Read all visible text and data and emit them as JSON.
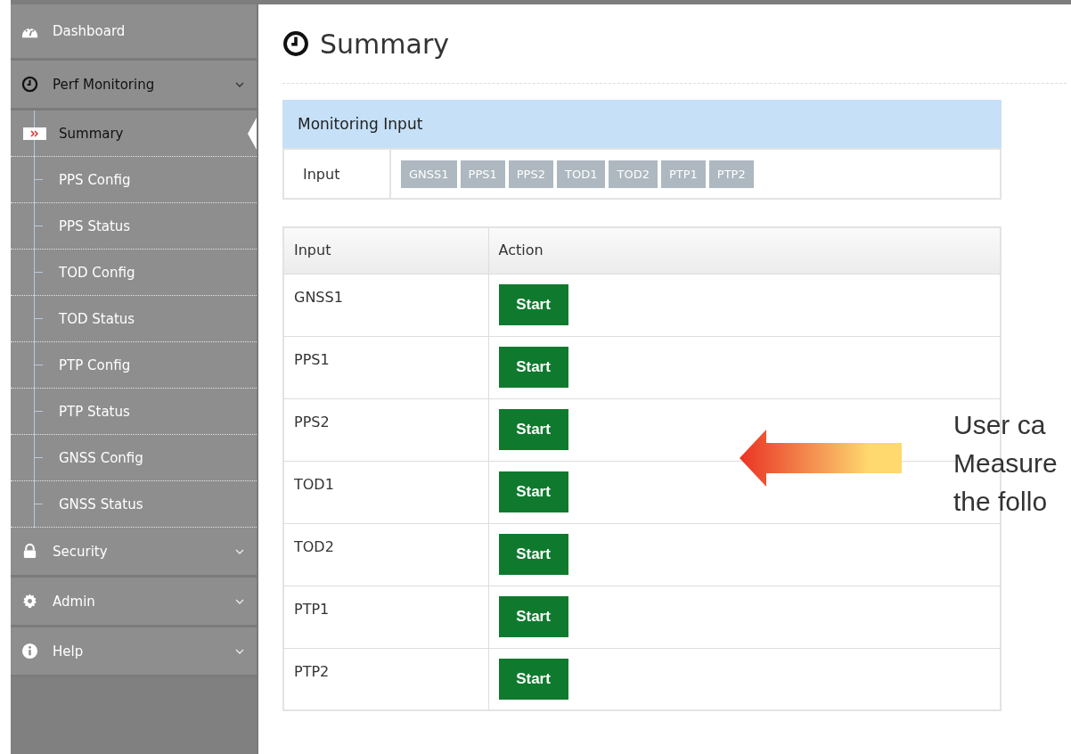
{
  "sidebar": {
    "items": [
      {
        "label": "Dashboard",
        "kind": "link"
      },
      {
        "label": "Perf Monitoring",
        "kind": "group",
        "expanded": true,
        "children": [
          {
            "label": "Summary",
            "selected": true
          },
          {
            "label": "PPS Config",
            "selected": false
          },
          {
            "label": "PPS Status",
            "selected": false
          },
          {
            "label": "TOD Config",
            "selected": false
          },
          {
            "label": "TOD Status",
            "selected": false
          },
          {
            "label": "PTP Config",
            "selected": false
          },
          {
            "label": "PTP Status",
            "selected": false
          },
          {
            "label": "GNSS Config",
            "selected": false
          },
          {
            "label": "GNSS Status",
            "selected": false
          }
        ]
      },
      {
        "label": "Security",
        "kind": "group",
        "expanded": false
      },
      {
        "label": "Admin",
        "kind": "group",
        "expanded": false
      },
      {
        "label": "Help",
        "kind": "group",
        "expanded": false
      }
    ]
  },
  "page": {
    "title": "Summary"
  },
  "monitoring_input": {
    "title": "Monitoring Input",
    "label": "Input",
    "chips": [
      "GNSS1",
      "PPS1",
      "PPS2",
      "TOD1",
      "TOD2",
      "PTP1",
      "PTP2"
    ]
  },
  "table": {
    "columns": [
      "Input",
      "Action"
    ],
    "rows": [
      {
        "input": "GNSS1",
        "action": "Start"
      },
      {
        "input": "PPS1",
        "action": "Start"
      },
      {
        "input": "PPS2",
        "action": "Start"
      },
      {
        "input": "TOD1",
        "action": "Start"
      },
      {
        "input": "TOD2",
        "action": "Start"
      },
      {
        "input": "PTP1",
        "action": "Start"
      },
      {
        "input": "PTP2",
        "action": "Start"
      }
    ]
  },
  "annotation": {
    "lines": [
      "User ca",
      "Measure",
      "the follo"
    ]
  }
}
